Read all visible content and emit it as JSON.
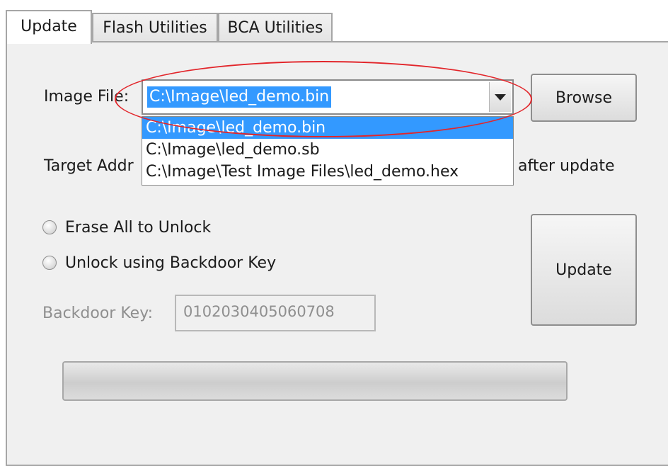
{
  "tabs": [
    {
      "label": "Update",
      "active": true
    },
    {
      "label": "Flash Utilities",
      "active": false
    },
    {
      "label": "BCA Utilities",
      "active": false
    }
  ],
  "image_file": {
    "label": "Image File:",
    "value": "C:\\Image\\led_demo.bin",
    "options": [
      "C:\\Image\\led_demo.bin",
      "C:\\Image\\led_demo.sb",
      "C:\\Image\\Test Image Files\\led_demo.hex"
    ],
    "selected_index": 0
  },
  "browse_label": "Browse",
  "target_address_partial": "Target Addr",
  "after_update_partial": "after update",
  "radios": [
    {
      "label": "Erase All to Unlock",
      "checked": false
    },
    {
      "label": "Unlock using Backdoor Key",
      "checked": false
    }
  ],
  "backdoor_key": {
    "label": "Backdoor Key:",
    "value": "0102030405060708",
    "disabled": true
  },
  "update_label": "Update",
  "progress": {
    "value": 0
  },
  "colors": {
    "selection": "#3399ff",
    "annotation": "#e2262b",
    "progress": "#06b025"
  }
}
